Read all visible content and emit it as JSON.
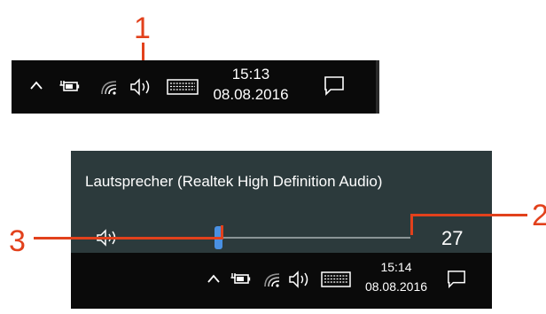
{
  "annotations": {
    "c1": "1",
    "c2": "2",
    "c3": "3"
  },
  "top_taskbar": {
    "time": "15:13",
    "date": "08.08.2016"
  },
  "volume_flyout": {
    "device_name": "Lautsprecher (Realtek High Definition Audio)",
    "volume": 27,
    "volume_label": "27"
  },
  "bottom_taskbar": {
    "time": "15:14",
    "date": "08.08.2016"
  },
  "colors": {
    "taskbar": "#0a0a0a",
    "flyout": "#2c3a3c",
    "slider_fill": "#4ba3f2",
    "slider_thumb": "#4a90e2",
    "annotation": "#e2411c"
  },
  "icons": {
    "tray": [
      "chevron-up-icon",
      "battery-icon",
      "wifi-icon",
      "speaker-icon",
      "keyboard-icon"
    ],
    "action_center": "notification-icon"
  }
}
